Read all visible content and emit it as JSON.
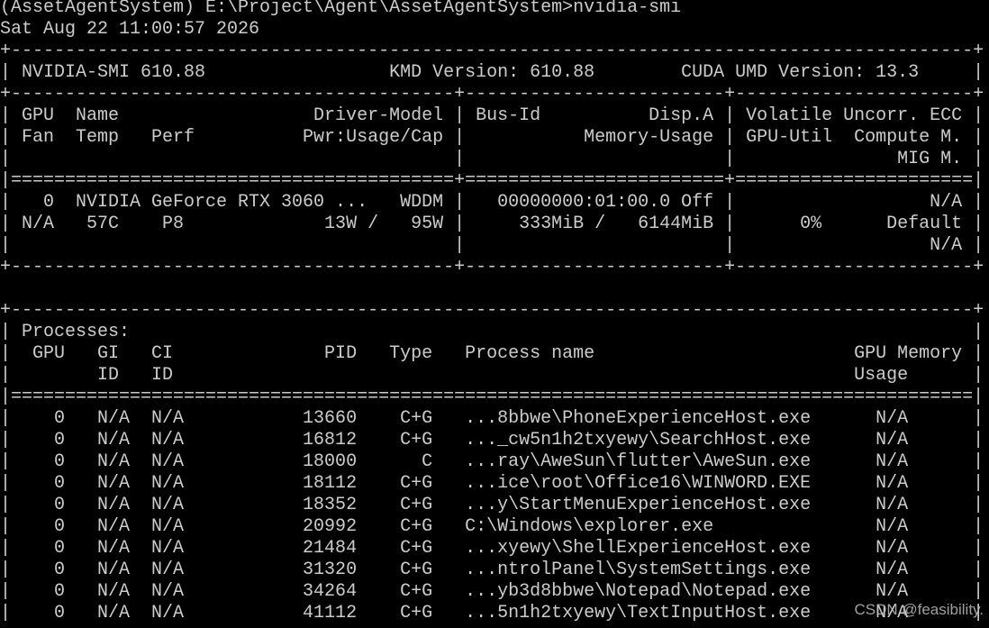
{
  "terminal": {
    "foreground": "#cccccc",
    "background": "#000000",
    "lines": [
      "(AssetAgentSystem) E:\\Project\\Agent\\AssetAgentSystem>nvidia-smi",
      "Sat Aug 22 11:00:57 2026",
      "+-----------------------------------------------------------------------------------------+",
      "| NVIDIA-SMI 610.88                 KMD Version: 610.88        CUDA UMD Version: 13.3     |",
      "+-----------------------------------------+------------------------+----------------------+",
      "| GPU  Name                  Driver-Model | Bus-Id          Disp.A | Volatile Uncorr. ECC |",
      "| Fan  Temp   Perf          Pwr:Usage/Cap |           Memory-Usage | GPU-Util  Compute M. |",
      "|                                         |                        |               MIG M. |",
      "|=========================================+========================+======================|",
      "|   0  NVIDIA GeForce RTX 3060 ...   WDDM |   00000000:01:00.0 Off |                  N/A |",
      "| N/A   57C    P8             13W /   95W |     333MiB /   6144MiB |      0%      Default |",
      "|                                         |                        |                  N/A |",
      "+-----------------------------------------+------------------------+----------------------+",
      "",
      "+-----------------------------------------------------------------------------------------+",
      "| Processes:                                                                              |",
      "|  GPU   GI   CI              PID   Type   Process name                        GPU Memory |",
      "|        ID   ID                                                               Usage      |",
      "|=========================================================================================|",
      "|    0   N/A  N/A           13660    C+G   ...8bbwe\\PhoneExperienceHost.exe      N/A      |",
      "|    0   N/A  N/A           16812    C+G   ..._cw5n1h2txyewy\\SearchHost.exe      N/A      |",
      "|    0   N/A  N/A           18000      C   ...ray\\AweSun\\flutter\\AweSun.exe      N/A      |",
      "|    0   N/A  N/A           18112    C+G   ...ice\\root\\Office16\\WINWORD.EXE      N/A      |",
      "|    0   N/A  N/A           18352    C+G   ...y\\StartMenuExperienceHost.exe      N/A      |",
      "|    0   N/A  N/A           20992    C+G   C:\\Windows\\explorer.exe               N/A      |",
      "|    0   N/A  N/A           21484    C+G   ...xyewy\\ShellExperienceHost.exe      N/A      |",
      "|    0   N/A  N/A           31320    C+G   ...ntrolPanel\\SystemSettings.exe      N/A      |",
      "|    0   N/A  N/A           34264    C+G   ...yb3d8bbwe\\Notepad\\Notepad.exe      N/A      |",
      "|    0   N/A  N/A           41112    C+G   ...5n1h2txyewy\\TextInputHost.exe      N/A      |"
    ]
  },
  "watermark": "CSDN @feasibility."
}
